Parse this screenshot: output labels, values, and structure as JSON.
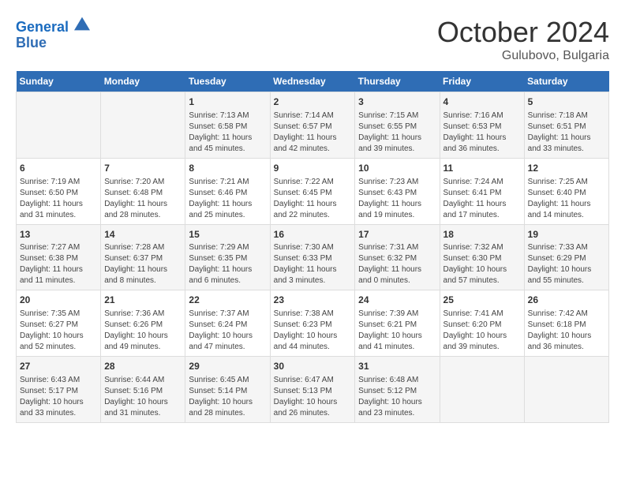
{
  "header": {
    "logo_line1": "General",
    "logo_line2": "Blue",
    "month": "October 2024",
    "location": "Gulubovo, Bulgaria"
  },
  "weekdays": [
    "Sunday",
    "Monday",
    "Tuesday",
    "Wednesday",
    "Thursday",
    "Friday",
    "Saturday"
  ],
  "weeks": [
    [
      {
        "day": "",
        "info": ""
      },
      {
        "day": "",
        "info": ""
      },
      {
        "day": "1",
        "info": "Sunrise: 7:13 AM\nSunset: 6:58 PM\nDaylight: 11 hours and 45 minutes."
      },
      {
        "day": "2",
        "info": "Sunrise: 7:14 AM\nSunset: 6:57 PM\nDaylight: 11 hours and 42 minutes."
      },
      {
        "day": "3",
        "info": "Sunrise: 7:15 AM\nSunset: 6:55 PM\nDaylight: 11 hours and 39 minutes."
      },
      {
        "day": "4",
        "info": "Sunrise: 7:16 AM\nSunset: 6:53 PM\nDaylight: 11 hours and 36 minutes."
      },
      {
        "day": "5",
        "info": "Sunrise: 7:18 AM\nSunset: 6:51 PM\nDaylight: 11 hours and 33 minutes."
      }
    ],
    [
      {
        "day": "6",
        "info": "Sunrise: 7:19 AM\nSunset: 6:50 PM\nDaylight: 11 hours and 31 minutes."
      },
      {
        "day": "7",
        "info": "Sunrise: 7:20 AM\nSunset: 6:48 PM\nDaylight: 11 hours and 28 minutes."
      },
      {
        "day": "8",
        "info": "Sunrise: 7:21 AM\nSunset: 6:46 PM\nDaylight: 11 hours and 25 minutes."
      },
      {
        "day": "9",
        "info": "Sunrise: 7:22 AM\nSunset: 6:45 PM\nDaylight: 11 hours and 22 minutes."
      },
      {
        "day": "10",
        "info": "Sunrise: 7:23 AM\nSunset: 6:43 PM\nDaylight: 11 hours and 19 minutes."
      },
      {
        "day": "11",
        "info": "Sunrise: 7:24 AM\nSunset: 6:41 PM\nDaylight: 11 hours and 17 minutes."
      },
      {
        "day": "12",
        "info": "Sunrise: 7:25 AM\nSunset: 6:40 PM\nDaylight: 11 hours and 14 minutes."
      }
    ],
    [
      {
        "day": "13",
        "info": "Sunrise: 7:27 AM\nSunset: 6:38 PM\nDaylight: 11 hours and 11 minutes."
      },
      {
        "day": "14",
        "info": "Sunrise: 7:28 AM\nSunset: 6:37 PM\nDaylight: 11 hours and 8 minutes."
      },
      {
        "day": "15",
        "info": "Sunrise: 7:29 AM\nSunset: 6:35 PM\nDaylight: 11 hours and 6 minutes."
      },
      {
        "day": "16",
        "info": "Sunrise: 7:30 AM\nSunset: 6:33 PM\nDaylight: 11 hours and 3 minutes."
      },
      {
        "day": "17",
        "info": "Sunrise: 7:31 AM\nSunset: 6:32 PM\nDaylight: 11 hours and 0 minutes."
      },
      {
        "day": "18",
        "info": "Sunrise: 7:32 AM\nSunset: 6:30 PM\nDaylight: 10 hours and 57 minutes."
      },
      {
        "day": "19",
        "info": "Sunrise: 7:33 AM\nSunset: 6:29 PM\nDaylight: 10 hours and 55 minutes."
      }
    ],
    [
      {
        "day": "20",
        "info": "Sunrise: 7:35 AM\nSunset: 6:27 PM\nDaylight: 10 hours and 52 minutes."
      },
      {
        "day": "21",
        "info": "Sunrise: 7:36 AM\nSunset: 6:26 PM\nDaylight: 10 hours and 49 minutes."
      },
      {
        "day": "22",
        "info": "Sunrise: 7:37 AM\nSunset: 6:24 PM\nDaylight: 10 hours and 47 minutes."
      },
      {
        "day": "23",
        "info": "Sunrise: 7:38 AM\nSunset: 6:23 PM\nDaylight: 10 hours and 44 minutes."
      },
      {
        "day": "24",
        "info": "Sunrise: 7:39 AM\nSunset: 6:21 PM\nDaylight: 10 hours and 41 minutes."
      },
      {
        "day": "25",
        "info": "Sunrise: 7:41 AM\nSunset: 6:20 PM\nDaylight: 10 hours and 39 minutes."
      },
      {
        "day": "26",
        "info": "Sunrise: 7:42 AM\nSunset: 6:18 PM\nDaylight: 10 hours and 36 minutes."
      }
    ],
    [
      {
        "day": "27",
        "info": "Sunrise: 6:43 AM\nSunset: 5:17 PM\nDaylight: 10 hours and 33 minutes."
      },
      {
        "day": "28",
        "info": "Sunrise: 6:44 AM\nSunset: 5:16 PM\nDaylight: 10 hours and 31 minutes."
      },
      {
        "day": "29",
        "info": "Sunrise: 6:45 AM\nSunset: 5:14 PM\nDaylight: 10 hours and 28 minutes."
      },
      {
        "day": "30",
        "info": "Sunrise: 6:47 AM\nSunset: 5:13 PM\nDaylight: 10 hours and 26 minutes."
      },
      {
        "day": "31",
        "info": "Sunrise: 6:48 AM\nSunset: 5:12 PM\nDaylight: 10 hours and 23 minutes."
      },
      {
        "day": "",
        "info": ""
      },
      {
        "day": "",
        "info": ""
      }
    ]
  ]
}
